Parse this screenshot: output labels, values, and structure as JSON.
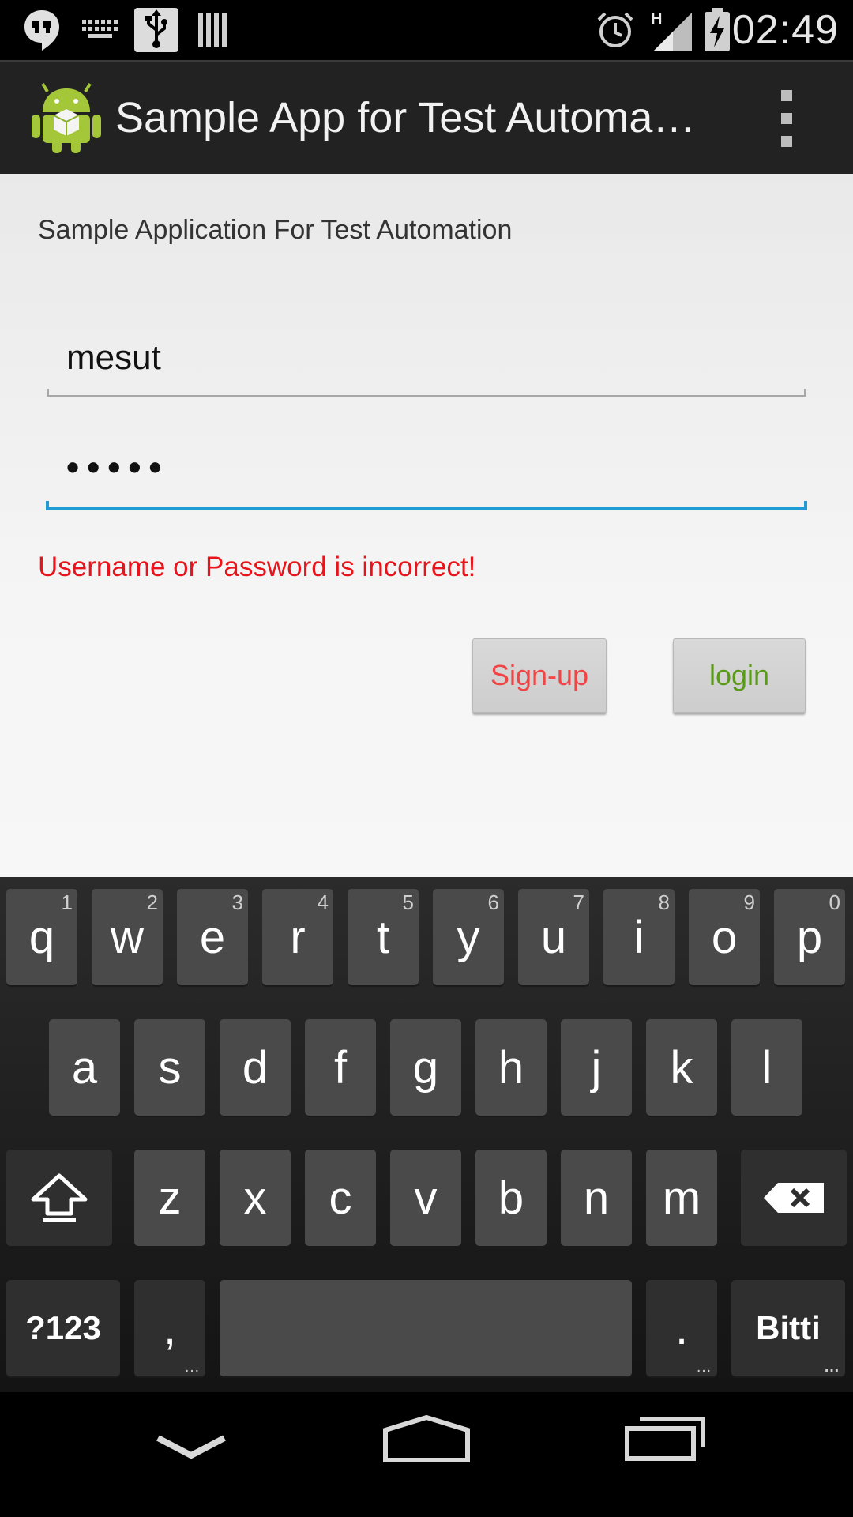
{
  "status_bar": {
    "time": "02:49",
    "left_icons": [
      "hangouts-icon",
      "keyboard-icon",
      "usb-icon",
      "barcode-icon"
    ],
    "right_icons": [
      "alarm-icon",
      "signal-h-icon",
      "battery-charging-icon"
    ],
    "signal_label": "H"
  },
  "action_bar": {
    "title": "Sample App for Test Automa…",
    "icon": "android-app-icon",
    "overflow_icon": "overflow-menu-icon"
  },
  "content": {
    "subtitle": "Sample Application For Test Automation",
    "username": {
      "value": "mesut"
    },
    "password": {
      "value": "•••••"
    },
    "error": "Username or Password is incorrect!",
    "error_color": "#e8141b",
    "buttons": {
      "signup": "Sign-up",
      "login": "login"
    }
  },
  "keyboard": {
    "row1": [
      {
        "k": "q",
        "h": "1"
      },
      {
        "k": "w",
        "h": "2"
      },
      {
        "k": "e",
        "h": "3"
      },
      {
        "k": "r",
        "h": "4"
      },
      {
        "k": "t",
        "h": "5"
      },
      {
        "k": "y",
        "h": "6"
      },
      {
        "k": "u",
        "h": "7"
      },
      {
        "k": "i",
        "h": "8"
      },
      {
        "k": "o",
        "h": "9"
      },
      {
        "k": "p",
        "h": "0"
      }
    ],
    "row2": [
      "a",
      "s",
      "d",
      "f",
      "g",
      "h",
      "j",
      "k",
      "l"
    ],
    "row3": [
      "z",
      "x",
      "c",
      "v",
      "b",
      "n",
      "m"
    ],
    "symbols": "?123",
    "comma": ",",
    "period": ".",
    "enter": "Bitti",
    "more_hint": "…",
    "shift_icon": "shift-icon",
    "backspace_icon": "backspace-icon"
  },
  "nav_bar": {
    "back_icon": "back-down-icon",
    "home_icon": "home-icon",
    "recents_icon": "recents-icon"
  },
  "colors": {
    "accent": "#1f9bd6",
    "signup_text": "#f04545",
    "login_text": "#5a9a1a"
  }
}
